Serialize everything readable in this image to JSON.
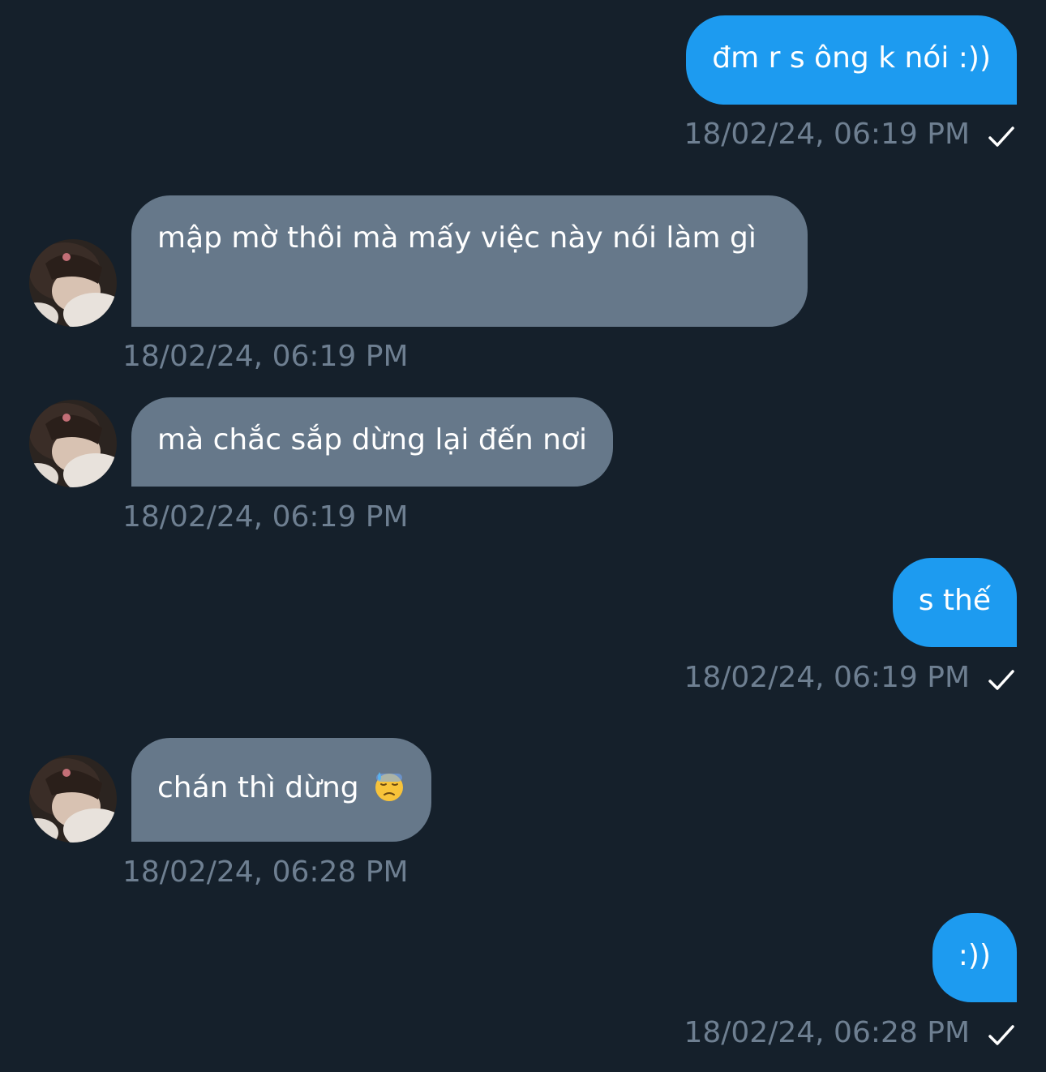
{
  "colors": {
    "background": "#15202b",
    "sent_bubble": "#1d9bf0",
    "received_bubble": "#66788a",
    "timestamp": "#6e7f91"
  },
  "messages": [
    {
      "direction": "sent",
      "text": "đm r s ông k nói :))",
      "timestamp": "18/02/24, 06:19 PM",
      "read_icon": "checkmark-icon"
    },
    {
      "direction": "received",
      "text": "mập mờ thôi mà mấy việc này nói làm gì",
      "timestamp": "18/02/24, 06:19 PM",
      "avatar": "avatar-photo"
    },
    {
      "direction": "received",
      "text": "mà chắc sắp dừng lại đến nơi",
      "timestamp": "18/02/24, 06:19 PM",
      "avatar": "avatar-photo"
    },
    {
      "direction": "sent",
      "text": "s thế",
      "timestamp": "18/02/24, 06:19 PM",
      "read_icon": "checkmark-icon"
    },
    {
      "direction": "received",
      "text": "chán thì dừng",
      "emoji": "downcast-face-with-sweat-emoji",
      "timestamp": "18/02/24, 06:28 PM",
      "avatar": "avatar-photo"
    },
    {
      "direction": "sent",
      "text": ":))",
      "timestamp": "18/02/24, 06:28 PM",
      "read_icon": "checkmark-icon"
    }
  ]
}
